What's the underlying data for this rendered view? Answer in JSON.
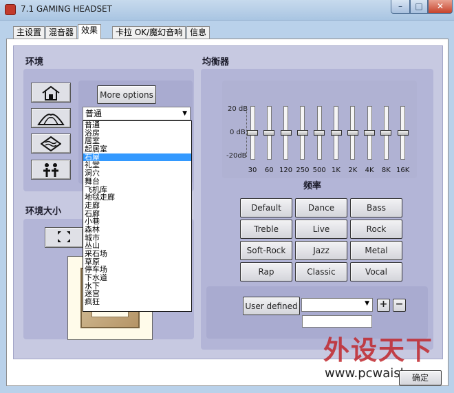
{
  "window": {
    "title": "7.1 GAMING HEADSET",
    "min": "–",
    "max": "□",
    "close": "✕"
  },
  "tabs": [
    "主设置",
    "混音器",
    "效果",
    "卡拉 OK/魔幻音响",
    "信息"
  ],
  "environment": {
    "header": "环境",
    "more_options": "More options",
    "selected": "普通",
    "options": [
      "普通",
      "浴房",
      "居室",
      "起居室",
      "石屋",
      "礼堂",
      "洞穴",
      "舞台",
      "飞机库",
      "地毯走廊",
      "走廊",
      "石廊",
      "小巷",
      "森林",
      "城市",
      "丛山",
      "采石场",
      "草原",
      "停车场",
      "下水道",
      "水下",
      "迷宫",
      "疯狂"
    ],
    "highlighted_index": 4,
    "icons": [
      "house-icon",
      "concert-hall-icon",
      "waves-icon",
      "people-icon"
    ]
  },
  "env_size": {
    "header": "环境大小",
    "button_icon": "expand-arrows-icon"
  },
  "equalizer": {
    "header": "均衡器",
    "db_labels": [
      "20 dB",
      "0 dB",
      "-20dB"
    ],
    "frequencies": [
      "30",
      "60",
      "120",
      "250",
      "500",
      "1K",
      "2K",
      "4K",
      "8K",
      "16K"
    ],
    "levels_db": [
      0,
      0,
      0,
      0,
      0,
      0,
      0,
      0,
      0,
      0
    ],
    "xlabel": "频率",
    "presets": [
      "Default",
      "Dance",
      "Bass",
      "Treble",
      "Live",
      "Rock",
      "Soft-Rock",
      "Jazz",
      "Metal",
      "Rap",
      "Classic",
      "Vocal"
    ],
    "user_defined": "User defined",
    "plus": "+",
    "minus": "−"
  },
  "watermark": {
    "text": "外设天下",
    "url": "www.pcwaishe.cn"
  },
  "ok_button": "确定",
  "colors": {
    "accent": "#3399ff",
    "panel": "#c7c9e1",
    "sub_panel": "#b3b5d7",
    "watermark": "#c0282d"
  }
}
